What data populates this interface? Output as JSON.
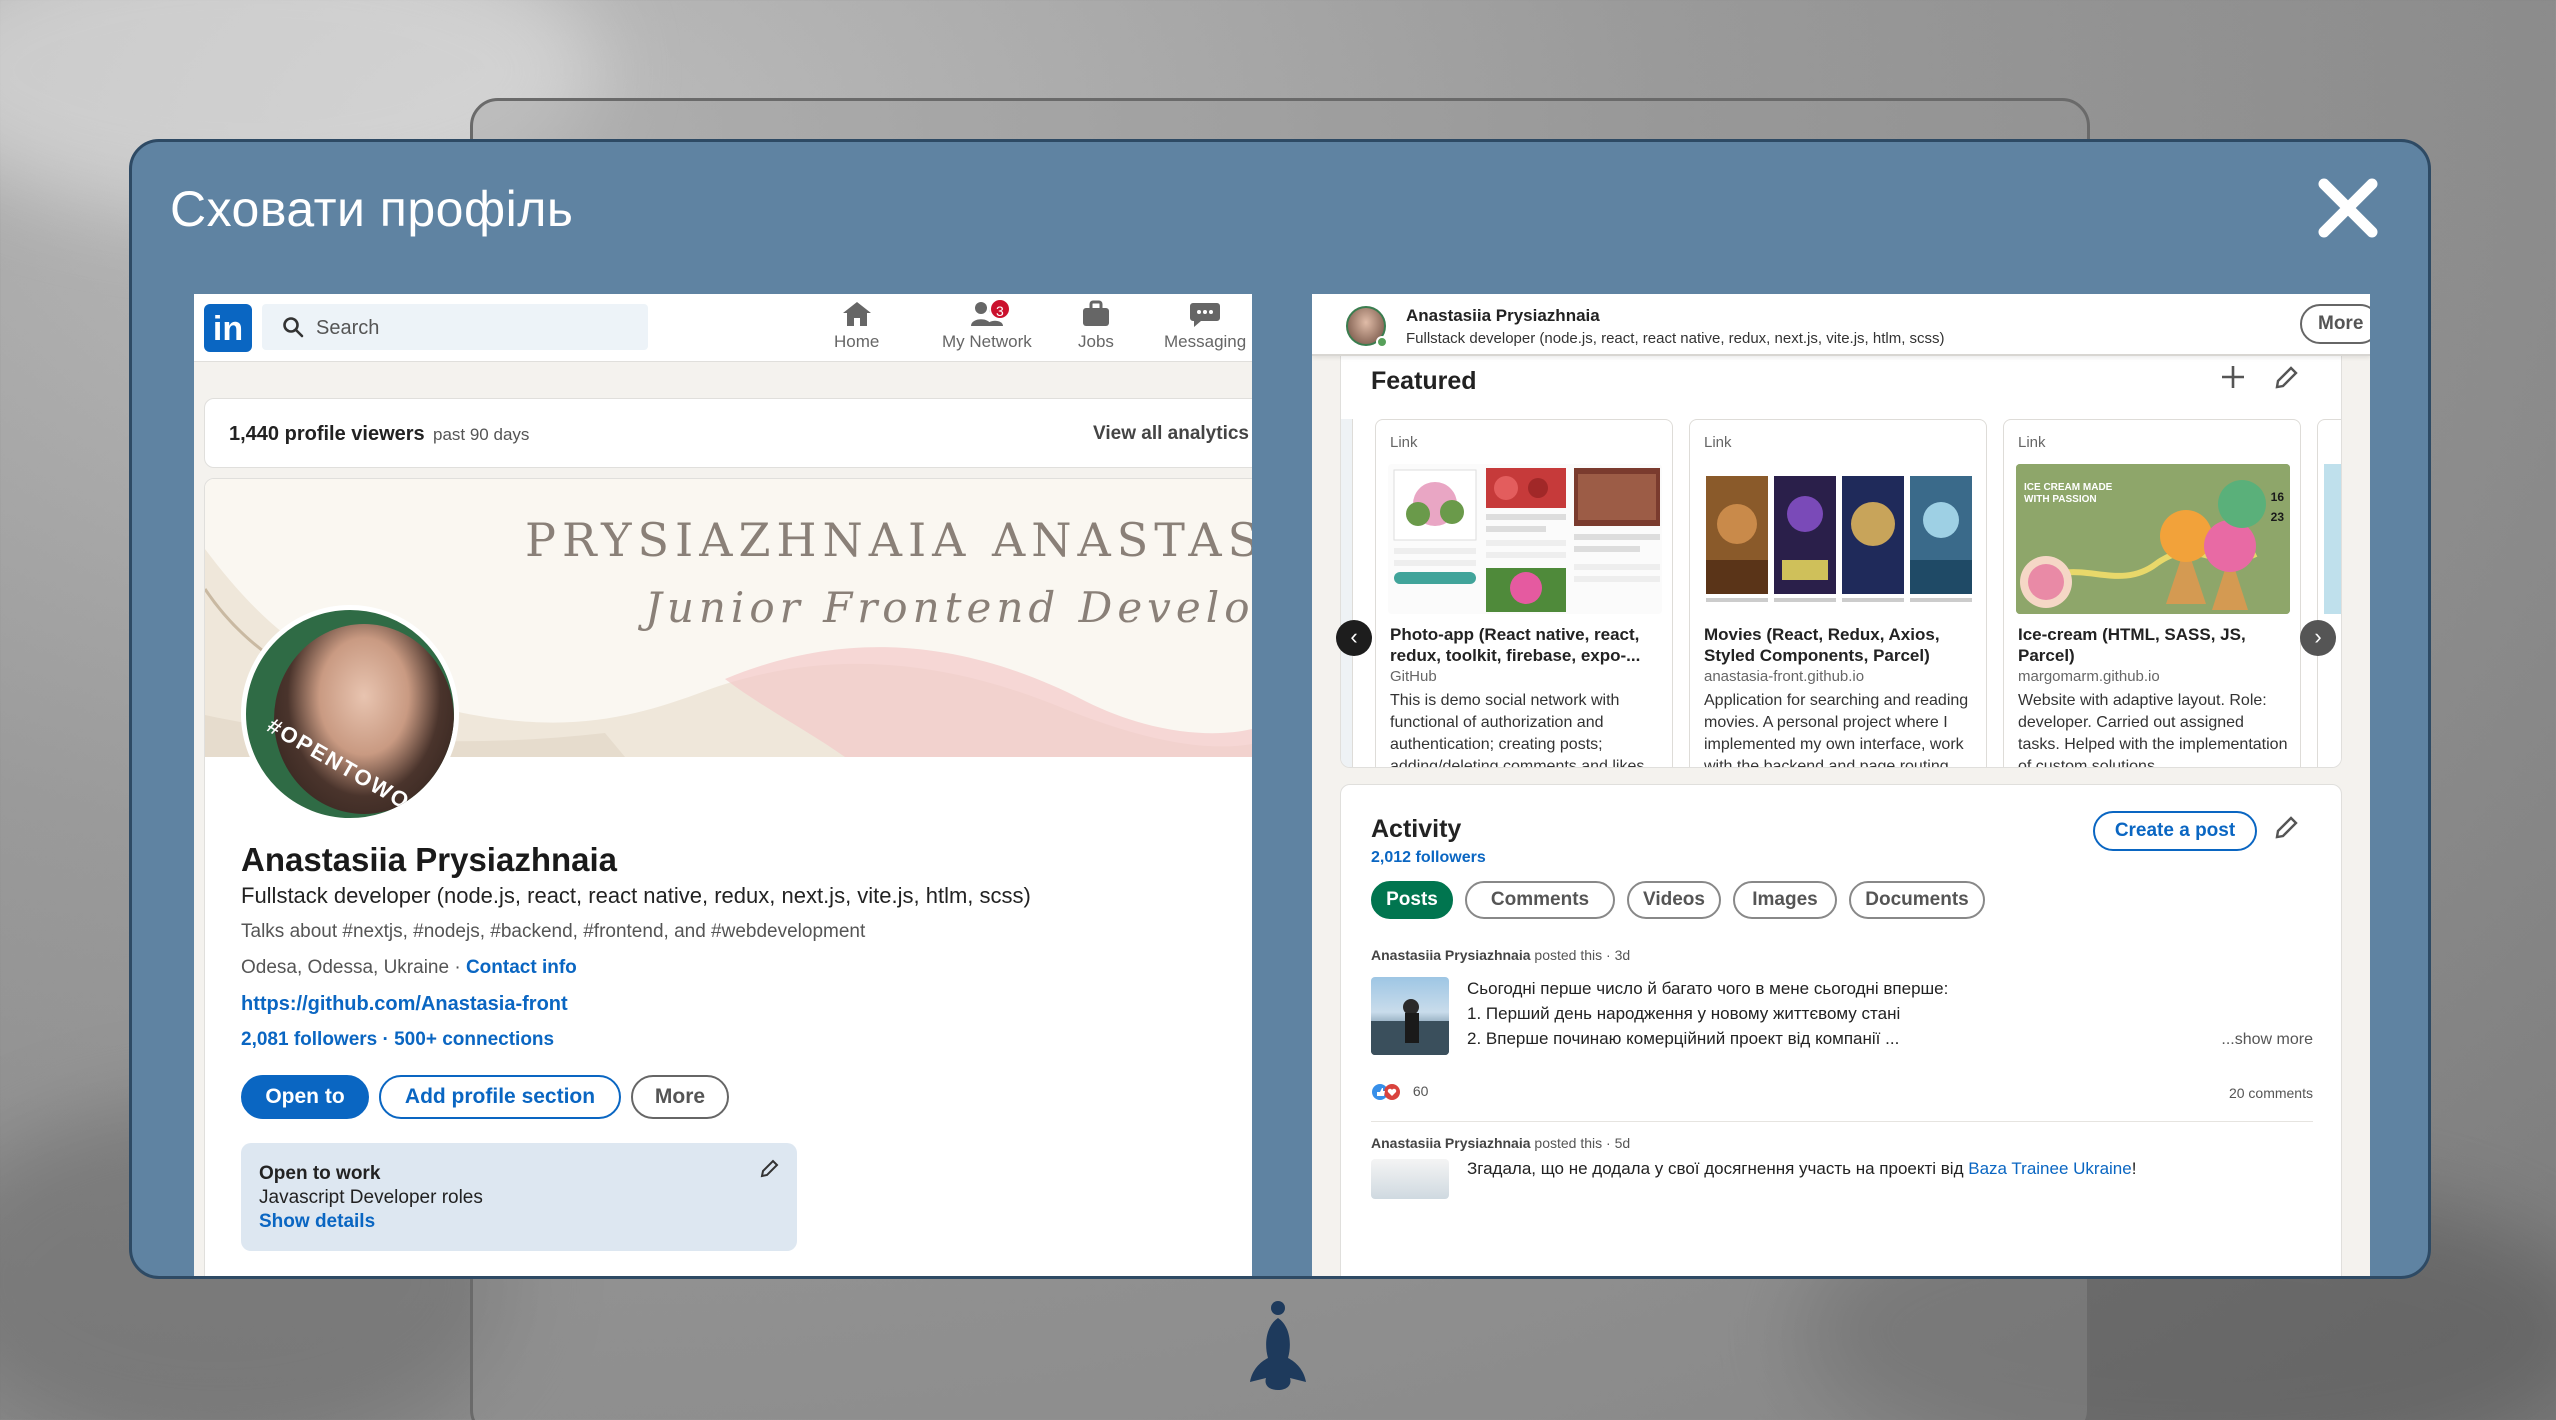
{
  "modal": {
    "title": "Сховати профіль"
  },
  "left": {
    "nav": {
      "search_placeholder": "Search",
      "items": [
        {
          "label": "Home",
          "icon": "home-icon"
        },
        {
          "label": "My Network",
          "icon": "network-icon",
          "badge": "3"
        },
        {
          "label": "Jobs",
          "icon": "briefcase-icon"
        },
        {
          "label": "Messaging",
          "icon": "messaging-icon"
        }
      ]
    },
    "viewers": {
      "count_text": "1,440 profile viewers",
      "period": "past 90 days",
      "link": "View all analytics"
    },
    "banner": {
      "name": "PRYSIAZHNAIA ANASTASIIA",
      "role": "Junior Frontend Developer"
    },
    "avatar_badge": "#OPENTOWORK",
    "profile": {
      "name": "Anastasiia Prysiazhnaia",
      "headline": "Fullstack developer (node.js, react, react native, redux, next.js, vite.js, htlm, scss)",
      "talks": "Talks about #nextjs, #nodejs, #backend, #frontend, and #webdevelopment",
      "location": "Odesa, Odessa, Ukraine · ",
      "contact_info": "Contact info",
      "github": "https://github.com/Anastasia-front",
      "followers": "2,081 followers",
      "connections": " · 500+ connections"
    },
    "buttons": {
      "open_to": "Open to",
      "add_section": "Add profile section",
      "more": "More"
    },
    "open_to_work": {
      "title": "Open to work",
      "roles": "Javascript Developer roles",
      "details": "Show details"
    }
  },
  "right": {
    "header": {
      "name": "Anastasiia Prysiazhnaia",
      "headline": "Fullstack developer (node.js, react, react native, redux, next.js, vite.js, htlm, scss)",
      "more": "More"
    },
    "featured": {
      "title": "Featured",
      "items": [
        {
          "tag": "Link",
          "title": "Photo-app (React native, react, redux, toolkit, firebase, expo-...",
          "source": "GitHub",
          "description": "This is demo social network with functional of authorization and authentication; creating posts; adding/deleting comments and likes to them; geolocation of publications; profile editing;..."
        },
        {
          "tag": "Link",
          "title": "Movies (React, Redux, Axios, Styled Components, Parcel)",
          "source": "anastasia-front.github.io",
          "description": "Application for searching and reading movies. A personal project where I implemented my own interface, work with the backend and page routing."
        },
        {
          "tag": "Link",
          "title": "Ice-cream (HTML, SASS, JS, Parcel)",
          "source": "margomarm.github.io",
          "description": "Website with adaptive layout. Role: developer. Carried out assigned tasks. Helped with the implementation of custom solutions."
        }
      ],
      "icecream_banner": "ICE CREAM MADE WITH PASSION",
      "icecream_nums": [
        "16",
        "23"
      ]
    },
    "activity": {
      "title": "Activity",
      "followers": "2,012 followers",
      "create_post": "Create a post",
      "tabs": [
        "Posts",
        "Comments",
        "Videos",
        "Images",
        "Documents"
      ],
      "post1": {
        "author": "Anastasiia Prysiazhnaia",
        "meta": " posted this · 3d",
        "lines": [
          "Сьогодні перше число й багато чого в мене сьогодні вперше:",
          "1. Перший день народження у новому життєвому стані",
          "2. Вперше починаю комерційний проект від компанії ..."
        ],
        "show_more": "...show more",
        "reactions": "60",
        "comments": "20 comments"
      },
      "post2": {
        "author": "Anastasiia Prysiazhnaia",
        "meta": " posted this · 5d",
        "text": "Згадала, що не додала у свої досягнення участь на проекті від ",
        "link": "Baza Trainee Ukraine",
        "tail": "!"
      }
    }
  },
  "colors": {
    "modal_bg": "#5f83a2",
    "linkedin_blue": "#0a66c2",
    "open_to_work_green": "#2f6b45",
    "posts_tab_green": "#01754f"
  }
}
